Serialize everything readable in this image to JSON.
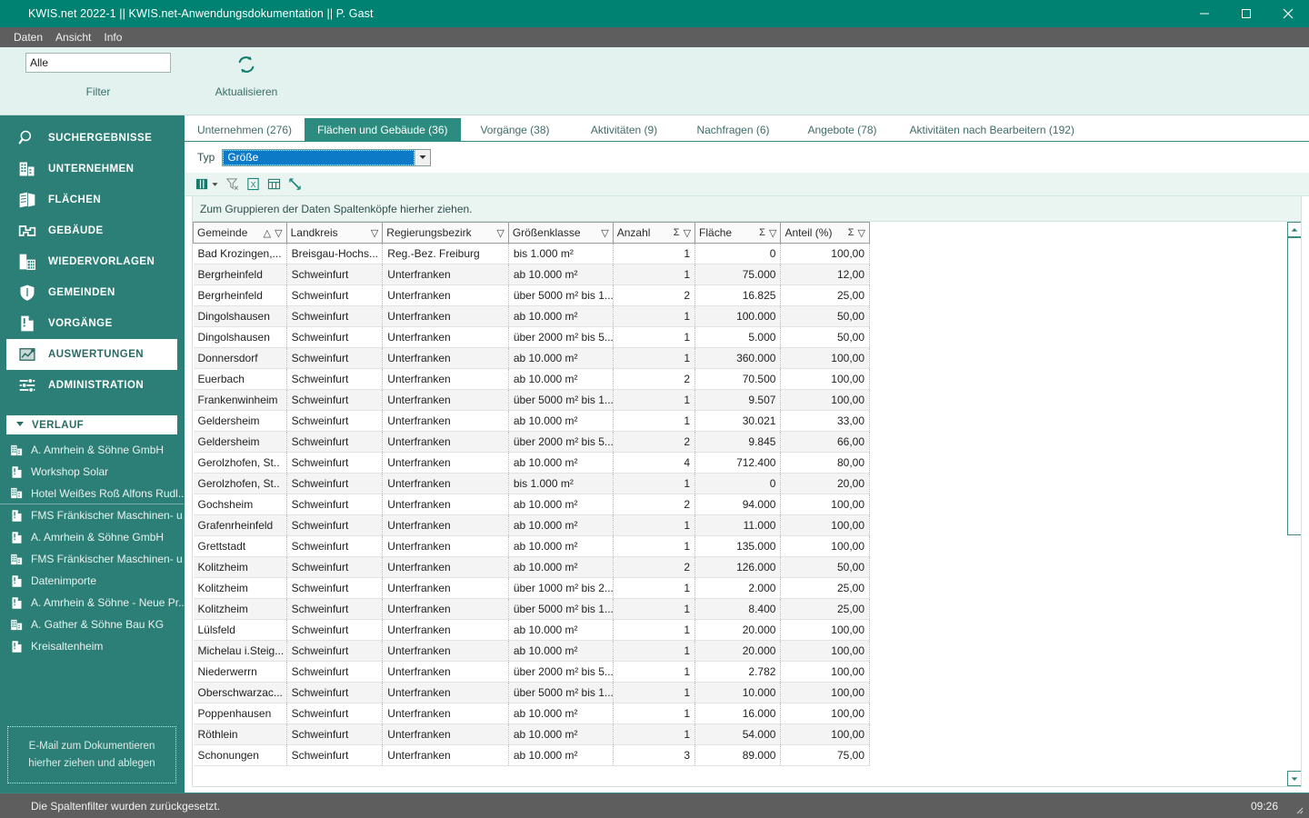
{
  "window": {
    "title": "KWIS.net 2022-1 || KWIS.net-Anwendungsdokumentation || P. Gast",
    "minimize": "−",
    "maximize": "□",
    "close": "✕"
  },
  "menubar": {
    "items": [
      "Daten",
      "Ansicht",
      "Info"
    ]
  },
  "ribbon": {
    "filter": {
      "value": "Alle",
      "placeholder": "Alle",
      "label": "Filter"
    },
    "refresh": {
      "label": "Aktualisieren",
      "icon": "refresh-icon"
    }
  },
  "sidebar": {
    "nav": [
      {
        "label": "SUCHERGEBNISSE",
        "icon": "search-icon",
        "active": false
      },
      {
        "label": "UNTERNEHMEN",
        "icon": "company-icon",
        "active": false
      },
      {
        "label": "FLÄCHEN",
        "icon": "areas-icon",
        "active": false
      },
      {
        "label": "GEBÄUDE",
        "icon": "building-icon",
        "active": false
      },
      {
        "label": "WIEDERVORLAGEN",
        "icon": "resubmission-icon",
        "active": false
      },
      {
        "label": "GEMEINDEN",
        "icon": "shield-icon",
        "active": false
      },
      {
        "label": "VORGÄNGE",
        "icon": "folder-icon",
        "active": false
      },
      {
        "label": "AUSWERTUNGEN",
        "icon": "chart-icon",
        "active": true
      },
      {
        "label": "ADMINISTRATION",
        "icon": "sliders-icon",
        "active": false
      }
    ],
    "history_header": {
      "label": "VERLAUF",
      "icon": "chevron-down-icon"
    },
    "history": [
      {
        "label": "A. Amrhein & Söhne GmbH",
        "icon": "company-icon"
      },
      {
        "label": "Workshop Solar",
        "icon": "folder-icon"
      },
      {
        "label": "Hotel Weißes Roß Alfons Rudl...",
        "icon": "company-icon"
      },
      {
        "label": "FMS Fränkischer Maschinen- u...",
        "icon": "folder-icon"
      },
      {
        "label": "A. Amrhein & Söhne GmbH",
        "icon": "folder-icon"
      },
      {
        "label": "FMS Fränkischer Maschinen- u...",
        "icon": "company-icon"
      },
      {
        "label": "Datenimporte",
        "icon": "folder-icon"
      },
      {
        "label": "A. Amrhein & Söhne - Neue Pr...",
        "icon": "folder-icon"
      },
      {
        "label": "A. Gather & Söhne Bau KG",
        "icon": "company-icon"
      },
      {
        "label": "Kreisaltenheim",
        "icon": "folder-icon"
      }
    ],
    "maildrop": {
      "line1": "E-Mail  zum Dokumentieren",
      "line2": "hierher ziehen und ablegen"
    }
  },
  "tabs": [
    {
      "label": "Unternehmen (276)",
      "active": false
    },
    {
      "label": "Flächen und Gebäude (36)",
      "active": true
    },
    {
      "label": "Vorgänge (38)",
      "active": false
    },
    {
      "label": "Aktivitäten (9)",
      "active": false
    },
    {
      "label": "Nachfragen (6)",
      "active": false
    },
    {
      "label": "Angebote (78)",
      "active": false
    },
    {
      "label": "Aktivitäten nach Bearbeitern (192)",
      "active": false
    }
  ],
  "typeselector": {
    "label": "Typ",
    "value": "Größe"
  },
  "gridtools": [
    {
      "name": "column-chooser-icon",
      "label": ""
    },
    {
      "name": "clear-filter-icon",
      "label": ""
    },
    {
      "name": "export-excel-icon",
      "label": ""
    },
    {
      "name": "export-table-icon",
      "label": ""
    },
    {
      "name": "expand-icon",
      "label": ""
    }
  ],
  "group_panel": {
    "text": "Zum Gruppieren der Daten Spaltenköpfe hierher ziehen."
  },
  "table": {
    "columns": [
      {
        "label": "Gemeinde",
        "sort": "△",
        "filter": "▽",
        "numeric": false
      },
      {
        "label": "Landkreis",
        "sort": "",
        "filter": "▽",
        "numeric": false
      },
      {
        "label": "Regierungsbezirk",
        "sort": "",
        "filter": "▽",
        "numeric": false
      },
      {
        "label": "Größenklasse",
        "sort": "",
        "filter": "▽",
        "numeric": false
      },
      {
        "label": "Anzahl",
        "sort": "Σ",
        "filter": "▽",
        "numeric": true
      },
      {
        "label": "Fläche",
        "sort": "Σ",
        "filter": "▽",
        "numeric": true
      },
      {
        "label": "Anteil (%)",
        "sort": "Σ",
        "filter": "▽",
        "numeric": true
      }
    ],
    "rows": [
      [
        "Bad  Krozingen,...",
        "Breisgau-Hochs...",
        "Reg.-Bez. Freiburg",
        "bis 1.000 m²",
        "1",
        "0",
        "100,00"
      ],
      [
        "Bergrheinfeld",
        "Schweinfurt",
        "Unterfranken",
        "ab 10.000 m²",
        "1",
        "75.000",
        "12,00"
      ],
      [
        "Bergrheinfeld",
        "Schweinfurt",
        "Unterfranken",
        "über 5000 m² bis 1...",
        "2",
        "16.825",
        "25,00"
      ],
      [
        "Dingolshausen",
        "Schweinfurt",
        "Unterfranken",
        "ab 10.000 m²",
        "1",
        "100.000",
        "50,00"
      ],
      [
        "Dingolshausen",
        "Schweinfurt",
        "Unterfranken",
        "über 2000 m² bis 5...",
        "1",
        "5.000",
        "50,00"
      ],
      [
        "Donnersdorf",
        "Schweinfurt",
        "Unterfranken",
        "ab 10.000 m²",
        "1",
        "360.000",
        "100,00"
      ],
      [
        "Euerbach",
        "Schweinfurt",
        "Unterfranken",
        "ab 10.000 m²",
        "2",
        "70.500",
        "100,00"
      ],
      [
        "Frankenwinheim",
        "Schweinfurt",
        "Unterfranken",
        "über 5000 m² bis 1...",
        "1",
        "9.507",
        "100,00"
      ],
      [
        "Geldersheim",
        "Schweinfurt",
        "Unterfranken",
        "ab 10.000 m²",
        "1",
        "30.021",
        "33,00"
      ],
      [
        "Geldersheim",
        "Schweinfurt",
        "Unterfranken",
        "über 2000 m² bis 5...",
        "2",
        "9.845",
        "66,00"
      ],
      [
        "Gerolzhofen, St..",
        "Schweinfurt",
        "Unterfranken",
        "ab 10.000 m²",
        "4",
        "712.400",
        "80,00"
      ],
      [
        "Gerolzhofen, St..",
        "Schweinfurt",
        "Unterfranken",
        "bis 1.000 m²",
        "1",
        "0",
        "20,00"
      ],
      [
        "Gochsheim",
        "Schweinfurt",
        "Unterfranken",
        "ab 10.000 m²",
        "2",
        "94.000",
        "100,00"
      ],
      [
        "Grafenrheinfeld",
        "Schweinfurt",
        "Unterfranken",
        "ab 10.000 m²",
        "1",
        "11.000",
        "100,00"
      ],
      [
        "Grettstadt",
        "Schweinfurt",
        "Unterfranken",
        "ab 10.000 m²",
        "1",
        "135.000",
        "100,00"
      ],
      [
        "Kolitzheim",
        "Schweinfurt",
        "Unterfranken",
        "ab 10.000 m²",
        "2",
        "126.000",
        "50,00"
      ],
      [
        "Kolitzheim",
        "Schweinfurt",
        "Unterfranken",
        "über 1000 m² bis 2...",
        "1",
        "2.000",
        "25,00"
      ],
      [
        "Kolitzheim",
        "Schweinfurt",
        "Unterfranken",
        "über 5000 m² bis 1...",
        "1",
        "8.400",
        "25,00"
      ],
      [
        "Lülsfeld",
        "Schweinfurt",
        "Unterfranken",
        "ab 10.000 m²",
        "1",
        "20.000",
        "100,00"
      ],
      [
        "Michelau i.Steig...",
        "Schweinfurt",
        "Unterfranken",
        "ab 10.000 m²",
        "1",
        "20.000",
        "100,00"
      ],
      [
        "Niederwerrn",
        "Schweinfurt",
        "Unterfranken",
        "über 2000 m² bis 5...",
        "1",
        "2.782",
        "100,00"
      ],
      [
        "Oberschwarzac...",
        "Schweinfurt",
        "Unterfranken",
        "über 5000 m² bis 1...",
        "1",
        "10.000",
        "100,00"
      ],
      [
        "Poppenhausen",
        "Schweinfurt",
        "Unterfranken",
        "ab 10.000 m²",
        "1",
        "16.000",
        "100,00"
      ],
      [
        "Röthlein",
        "Schweinfurt",
        "Unterfranken",
        "ab 10.000 m²",
        "1",
        "54.000",
        "100,00"
      ],
      [
        "Schonungen",
        "Schweinfurt",
        "Unterfranken",
        "ab 10.000 m²",
        "3",
        "89.000",
        "75,00"
      ]
    ]
  },
  "statusbar": {
    "message": "Die Spaltenfilter wurden zurückgesetzt.",
    "clock": "09:26"
  },
  "colors": {
    "titlebar": "#008272",
    "accent": "#2b8c7f",
    "sidebar": "#2b7f76",
    "ribbon": "#e3f2ef",
    "menubar": "#5e5e5e",
    "selection_blue": "#0d7ac7"
  }
}
